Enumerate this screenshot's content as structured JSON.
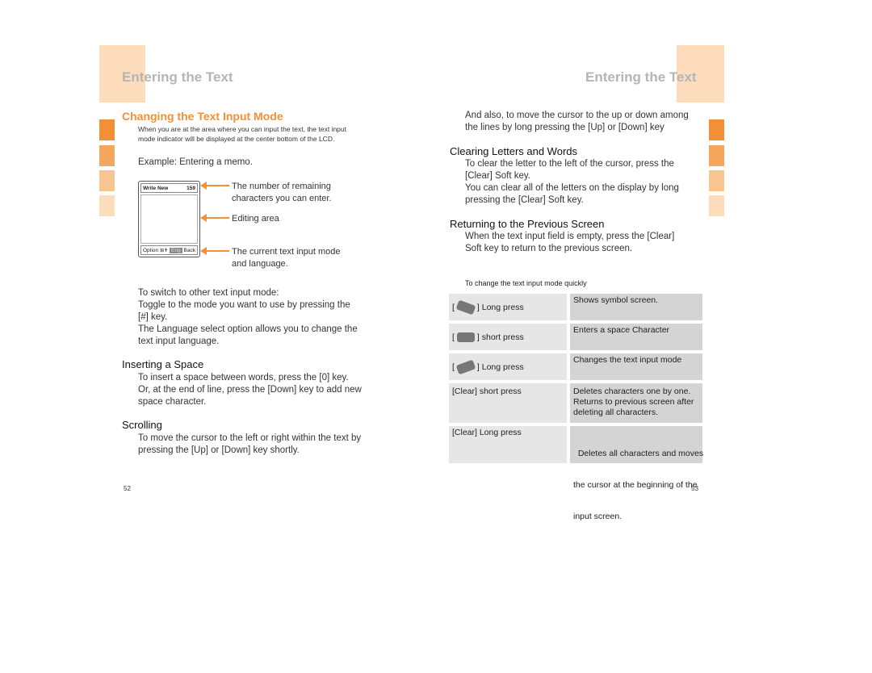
{
  "left_page": {
    "title": "Entering the Text",
    "section_title": "Changing the Text Input Mode",
    "intro_lines": [
      "When you are at the area where you can input the text, the text input",
      "mode indicator will be displayed at the center bottom of the LCD."
    ],
    "example": "Example: Entering a memo.",
    "phone": {
      "header_label": "Write New",
      "char_count": "159",
      "softkey_left": "Option",
      "mode_icons": "⊞✝",
      "mode": "Eng",
      "softkey_right": "Back"
    },
    "callouts": [
      [
        "The number of remaining",
        "characters you can enter."
      ],
      [
        "Editing area"
      ],
      [
        "The current text input mode",
        "and language."
      ]
    ],
    "switch_lines": [
      "To switch to other text input mode:",
      "Toggle to the mode you want to use by pressing the",
      "[#] key.",
      "The Language select option allows you to change the",
      "text input language."
    ],
    "inserting": {
      "heading": "Inserting a Space",
      "lines": [
        "To insert a space between words, press the [0] key.",
        "Or, at the end of line, press the [Down] key to add new",
        "space character."
      ]
    },
    "scrolling": {
      "heading": "Scrolling",
      "lines": [
        "To move the cursor to the left or right within the text by",
        "pressing the [Up] or [Down] key shortly."
      ]
    },
    "page_number": "52"
  },
  "right_page": {
    "title": "Entering the Text",
    "intro_lines": [
      "And also, to move the cursor to the up or down among",
      "the lines by long pressing the [Up] or [Down] key"
    ],
    "clearing": {
      "heading": "Clearing Letters and Words",
      "lines": [
        "To clear the letter to the left of the cursor, press the",
        "[Clear] Soft key.",
        "You can clear all of the letters on the display by long",
        "pressing the [Clear] Soft key."
      ]
    },
    "returning": {
      "heading": "Returning to the Previous Screen",
      "lines": [
        "When the text input field is empty, press the [Clear]",
        "Soft key to return to the previous screen."
      ]
    },
    "table_caption": "To change the text input mode quickly",
    "table_rows": [
      {
        "key_icon": "star-key-icon",
        "action": "] Long press",
        "result": [
          "Shows symbol screen."
        ]
      },
      {
        "key_icon": "zero-key-icon",
        "action": "] short press",
        "result": [
          "Enters a space Character"
        ]
      },
      {
        "key_icon": "hash-key-icon",
        "action": "] Long press",
        "result": [
          "Changes the text input mode"
        ]
      },
      {
        "key_icon": "",
        "action": "[Clear] short press",
        "result": [
          "Deletes characters one by one.",
          "Returns to previous screen after",
          "deleting all characters."
        ]
      },
      {
        "key_icon": "",
        "action": "[Clear] Long press",
        "result": [
          "  Deletes all characters and moves",
          "the cursor at the beginning of the",
          "input screen."
        ]
      }
    ],
    "page_number": "53"
  }
}
